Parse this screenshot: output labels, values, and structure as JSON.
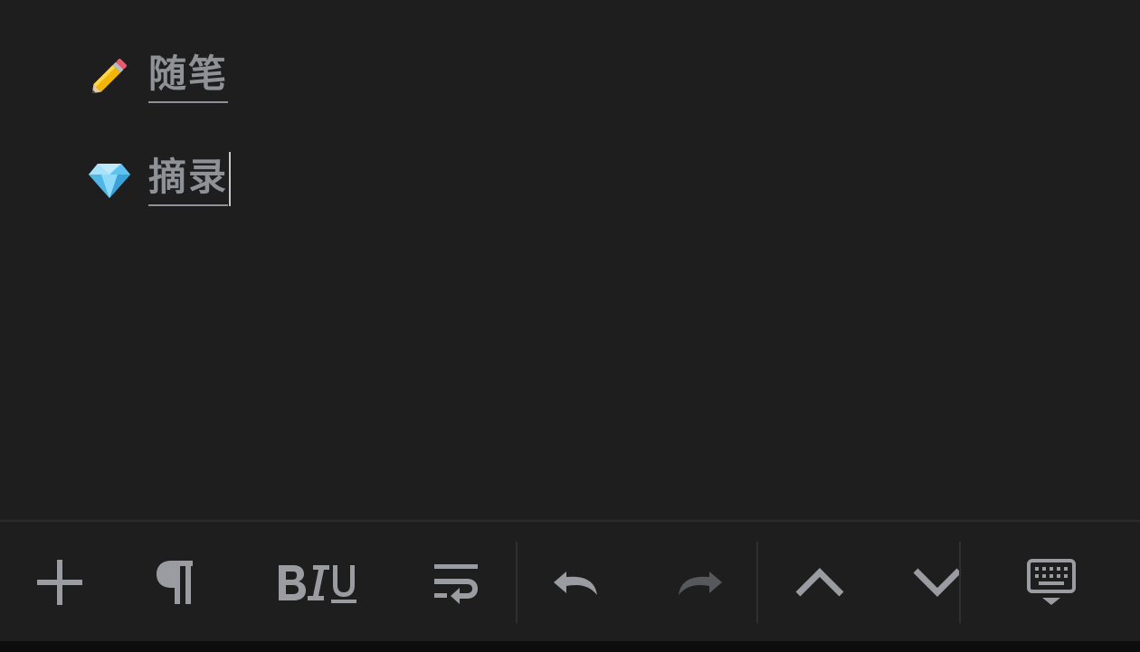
{
  "document": {
    "items": [
      {
        "icon": "pencil-icon",
        "label": "随笔"
      },
      {
        "icon": "gem-icon",
        "label": "摘录"
      }
    ]
  },
  "toolbar": {
    "buttons": [
      {
        "icon": "plus-icon"
      },
      {
        "icon": "paragraph-icon"
      },
      {
        "icon": "bold-italic-underline-icon"
      },
      {
        "icon": "wrap-text-icon"
      },
      {
        "icon": "undo-icon"
      },
      {
        "icon": "redo-icon",
        "disabled": true
      },
      {
        "icon": "chevron-up-icon"
      },
      {
        "icon": "chevron-down-icon"
      },
      {
        "icon": "keyboard-hide-icon"
      }
    ]
  },
  "colors": {
    "background": "#1e1e1f",
    "text": "#8e9196",
    "icon": "#9a9ca1",
    "icon_disabled": "#56585c"
  }
}
